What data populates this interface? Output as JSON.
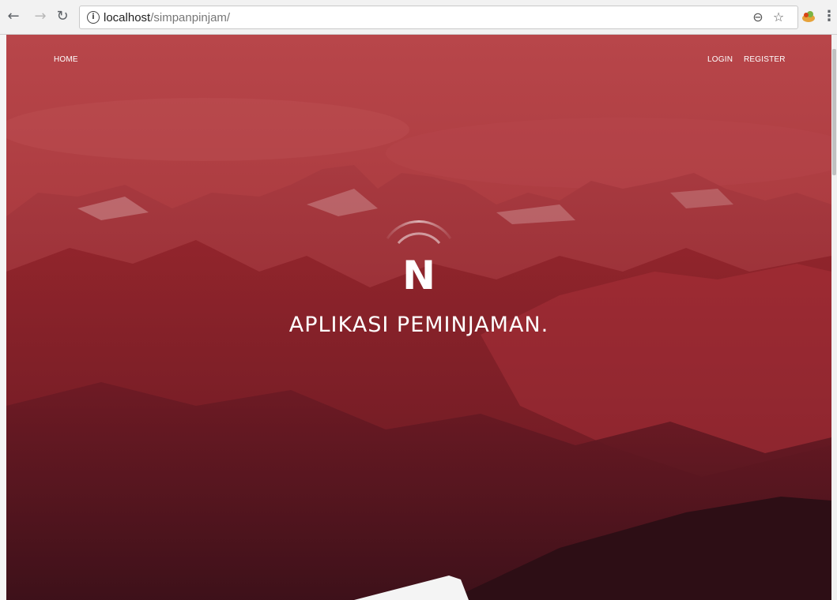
{
  "browser": {
    "url_host": "localhost",
    "url_path": "/simpanpinjam/",
    "back_icon": "arrow-left",
    "forward_icon": "arrow-right",
    "reload_icon": "reload",
    "info_icon": "info",
    "zoom_icon": "magnifier-minus",
    "bookmark_icon": "star",
    "extension_icon": "extension",
    "menu_icon": "kebab-menu"
  },
  "site_nav": {
    "home": "HOME",
    "login": "LOGIN",
    "register": "REGISTER"
  },
  "hero": {
    "headline": "APLIKASI PEMINJAMAN.",
    "logo_letter": "N",
    "accent_color": "#a8262d"
  }
}
